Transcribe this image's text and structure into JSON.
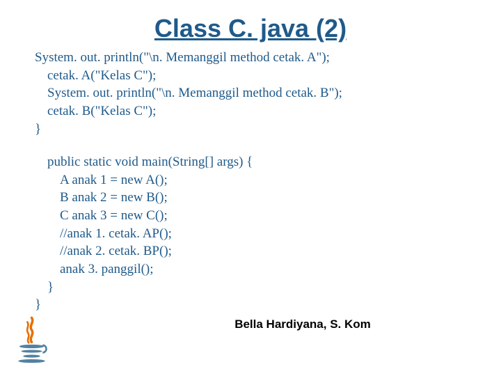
{
  "title": "Class C. java (2)",
  "code": {
    "block1": [
      {
        "indent": 1,
        "text": "System. out. println(\"\\n. Memanggil method cetak. A\");"
      },
      {
        "indent": 2,
        "text": "cetak. A(\"Kelas C\");"
      },
      {
        "indent": 2,
        "text": "System. out. println(\"\\n. Memanggil method cetak. B\");"
      },
      {
        "indent": 2,
        "text": "cetak. B(\"Kelas C\");"
      },
      {
        "indent": 1,
        "text": "}"
      }
    ],
    "block2": [
      {
        "indent": 2,
        "text": "public static void main(String[] args) {"
      },
      {
        "indent": 3,
        "text": "A anak 1 = new A();"
      },
      {
        "indent": 3,
        "text": "B anak 2 = new B();"
      },
      {
        "indent": 3,
        "text": "C anak 3 = new C();"
      },
      {
        "indent": 3,
        "text": "//anak 1. cetak. AP();"
      },
      {
        "indent": 3,
        "text": "//anak 2. cetak. BP();"
      },
      {
        "indent": 3,
        "text": "anak 3. panggil();"
      },
      {
        "indent": 2,
        "text": "}"
      },
      {
        "indent": 1,
        "text": "}"
      }
    ]
  },
  "footer": "Bella Hardiyana, S. Kom",
  "logo_alt": "java-logo"
}
